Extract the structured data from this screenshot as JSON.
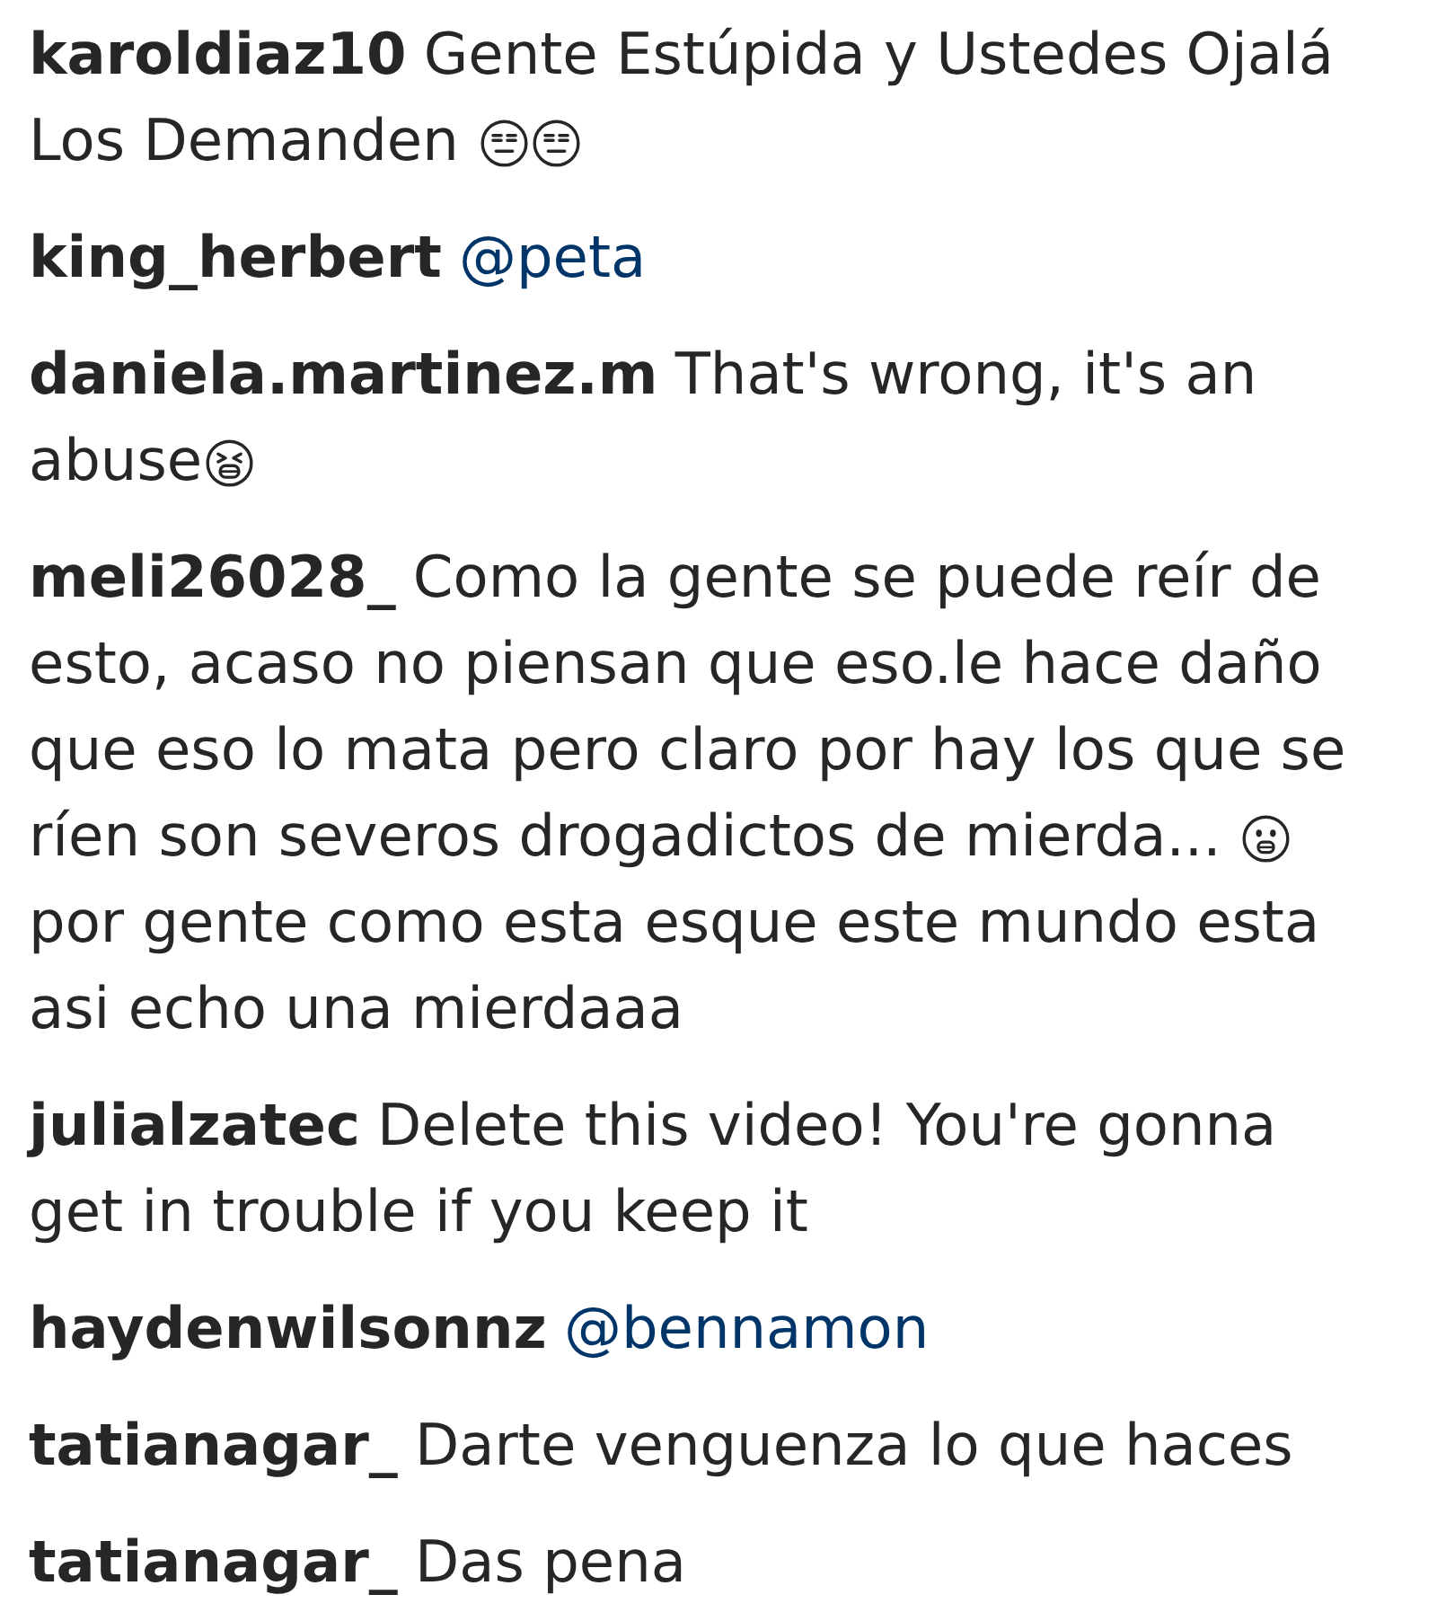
{
  "comments": [
    {
      "username": "karoldiaz10",
      "parts": [
        {
          "kind": "text",
          "text": "Gente Estúpida y Ustedes Ojalá Los Demanden "
        },
        {
          "kind": "expressionless"
        },
        {
          "kind": "expressionless"
        }
      ]
    },
    {
      "username": "king_herbert",
      "parts": [
        {
          "kind": "mention",
          "text": "@peta"
        }
      ]
    },
    {
      "username": "daniela.martinez.m",
      "parts": [
        {
          "kind": "text",
          "text": "That's wrong, it's an abuse"
        },
        {
          "kind": "weary"
        }
      ]
    },
    {
      "username": "meli26028_",
      "parts": [
        {
          "kind": "text",
          "text": "Como la gente se puede reír de esto, acaso no piensan que eso.le hace daño que eso lo mata pero claro por hay los que se ríen son severos drogadictos de mierda... "
        },
        {
          "kind": "grimacing"
        },
        {
          "kind": "text",
          "text": " por gente como esta esque este mundo esta asi echo una mierdaaa"
        }
      ]
    },
    {
      "username": "julialzatec",
      "parts": [
        {
          "kind": "text",
          "text": "Delete this video! You're gonna get in trouble if you keep it"
        }
      ]
    },
    {
      "username": "haydenwilsonnz",
      "parts": [
        {
          "kind": "mention",
          "text": "@bennamon"
        }
      ]
    },
    {
      "username": "tatianagar_",
      "parts": [
        {
          "kind": "text",
          "text": "Darte venguenza lo que haces"
        }
      ]
    },
    {
      "username": "tatianagar_",
      "parts": [
        {
          "kind": "text",
          "text": "Das pena"
        }
      ]
    }
  ]
}
